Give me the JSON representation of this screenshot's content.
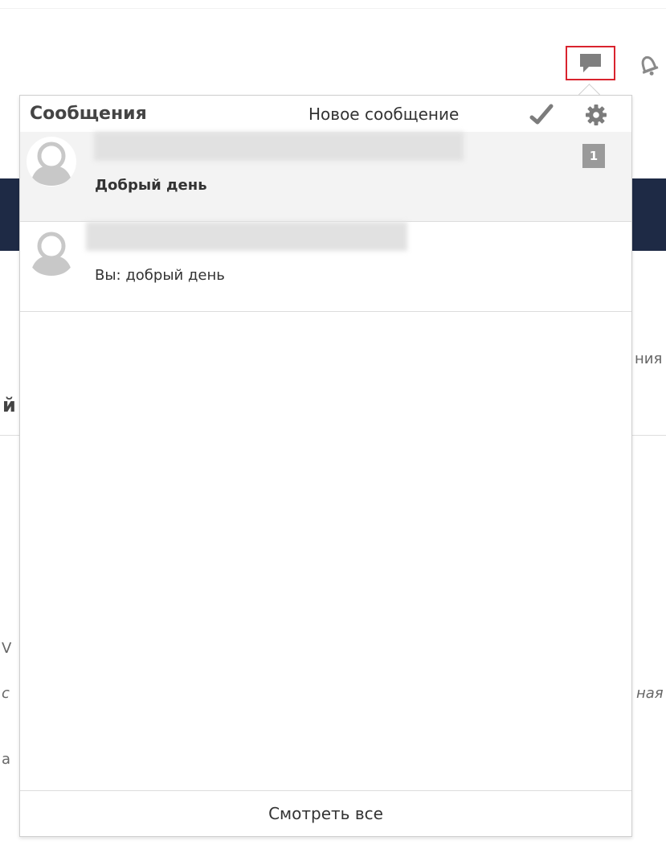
{
  "navbar": {
    "messages_icon": "speech-bubble-icon",
    "notifications_icon": "bell-icon",
    "highlight_color": "#d9232e"
  },
  "popover": {
    "title": "Сообщения",
    "new_message_label": "Новое сообщение",
    "mark_read_icon": "checkmark-icon",
    "settings_icon": "gear-icon",
    "conversations": [
      {
        "sender": "",
        "preview": "Добрый день",
        "unread_count": "1",
        "unread": true
      },
      {
        "sender": "",
        "preview": "Вы: добрый день",
        "unread": false
      }
    ],
    "footer_label": "Смотреть все"
  },
  "background": {
    "fragment_1": "ния",
    "fragment_2": "й",
    "fragment_3": "V",
    "fragment_4": "с",
    "fragment_5": "ная",
    "fragment_6": "а",
    "band_color": "#1e2a45"
  }
}
